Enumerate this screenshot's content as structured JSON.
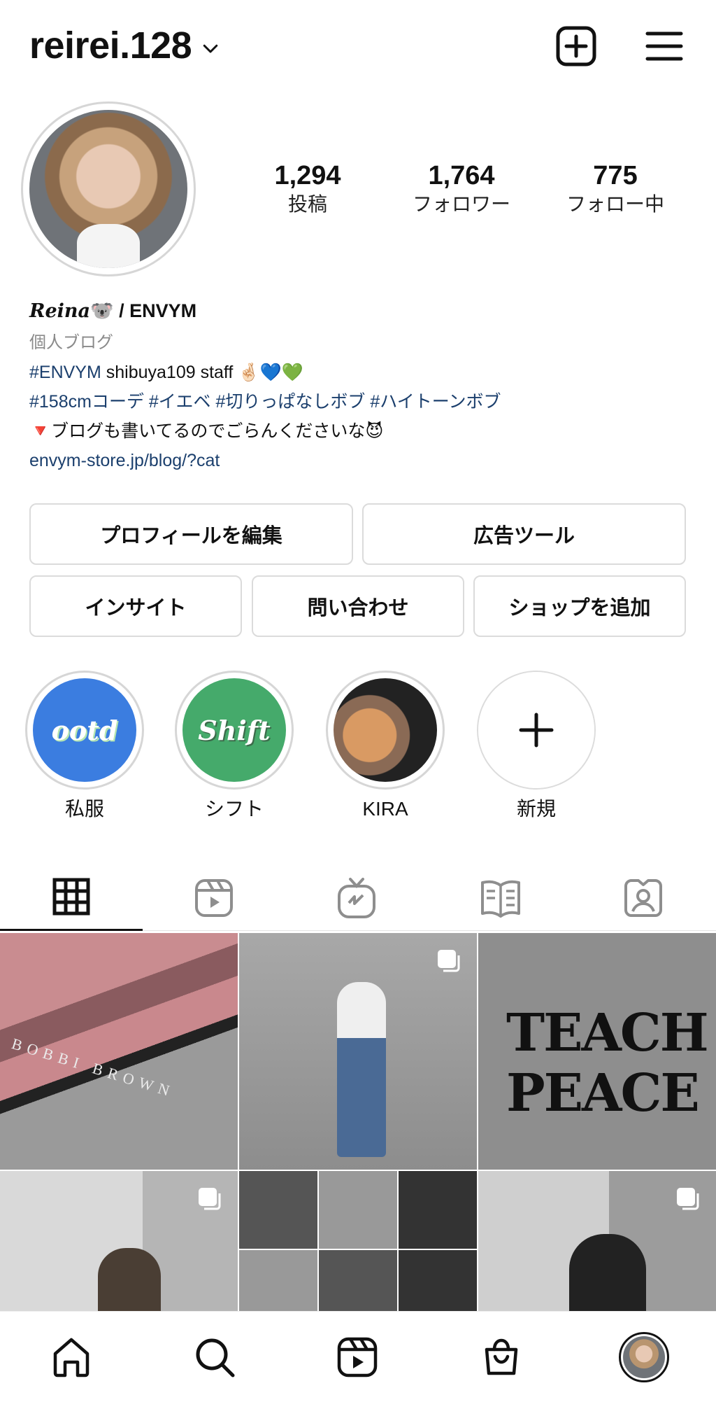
{
  "header": {
    "username": "reirei.128"
  },
  "profile": {
    "stats": [
      {
        "value": "1,294",
        "label": "投稿"
      },
      {
        "value": "1,764",
        "label": "フォロワー"
      },
      {
        "value": "775",
        "label": "フォロー中"
      }
    ],
    "name_display": "Reina",
    "name_suffix": "🐨 / ENVYM",
    "category": "個人ブログ",
    "bio_lines": [
      {
        "tag": "#ENVYM",
        "text": " shibuya109 staff 🤞🏻💙💚"
      },
      {
        "tag": "#158cmコーデ #イエベ #切りっぱなしボブ #ハイトーンボブ",
        "text": ""
      },
      {
        "tag": "",
        "text": "🔻ブログも書いてるのでごらんくださいな😈"
      }
    ],
    "link": "envym-store.jp/blog/?cat"
  },
  "buttons": {
    "edit_profile": "プロフィールを編集",
    "ad_tools": "広告ツール",
    "insights": "インサイト",
    "contact": "問い合わせ",
    "add_shop": "ショップを追加"
  },
  "highlights": [
    {
      "label": "私服",
      "cover_text": "ootd",
      "color": "#3b7de0"
    },
    {
      "label": "シフト",
      "cover_text": "Shift",
      "color": "#45aa6b"
    },
    {
      "label": "KIRA",
      "cover_text": "",
      "color": "#222222"
    },
    {
      "label": "新規",
      "cover_text": "+",
      "color": "#ffffff"
    }
  ],
  "tabs": [
    "grid-icon",
    "reels-icon",
    "igtv-icon",
    "guides-icon",
    "tagged-icon"
  ],
  "grid_posts": [
    {
      "overlay_text": "BOBBI BROWN"
    },
    {
      "overlay_text": ""
    },
    {
      "overlay_text": "TEACH PEACE"
    },
    {
      "overlay_text": ""
    },
    {
      "overlay_text": ""
    },
    {
      "overlay_text": ""
    }
  ],
  "bottom_nav": [
    "home-icon",
    "search-icon",
    "reels-icon",
    "shop-icon",
    "profile-avatar"
  ]
}
